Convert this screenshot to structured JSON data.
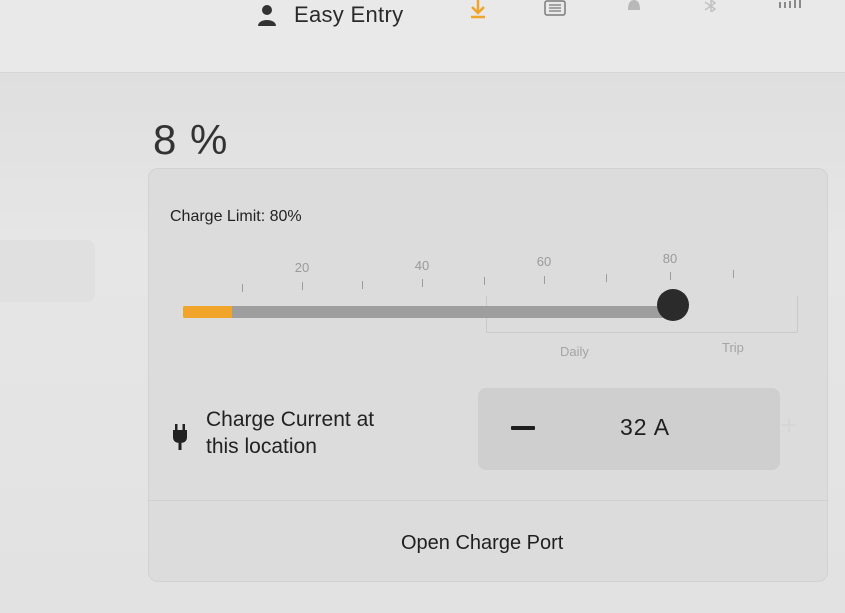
{
  "header": {
    "profile_name": "Easy Entry",
    "icons": [
      "person-icon",
      "download-icon",
      "list-icon",
      "bell-icon",
      "bluetooth-icon",
      "signal-icon"
    ]
  },
  "battery": {
    "percent_text": "8 %",
    "level": 8
  },
  "charge_limit": {
    "label": "Charge Limit: 80%",
    "value": 80,
    "tick_labels": [
      "20",
      "40",
      "60",
      "80"
    ],
    "range_labels": [
      "Daily",
      "Trip"
    ]
  },
  "charge_current": {
    "label_line1": "Charge Current at",
    "label_line2": "this location",
    "value": "32 A",
    "minus_label": "—",
    "plus_label": "+"
  },
  "actions": {
    "open_charge_port": "Open Charge Port"
  },
  "colors": {
    "accent_orange": "#f0a52a",
    "track_gray": "#9e9e9e",
    "thumb": "#2b2b2b"
  }
}
